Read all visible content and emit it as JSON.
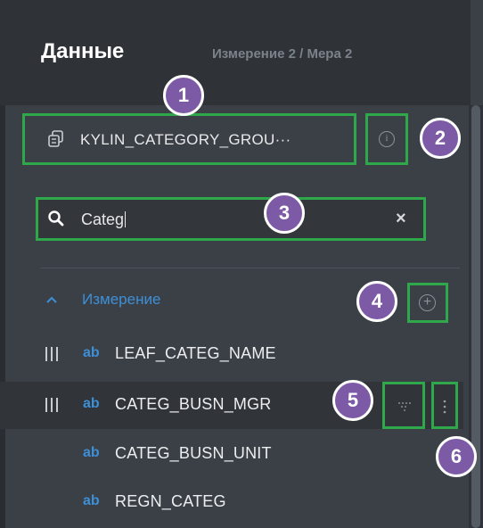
{
  "header": {
    "title": "Данные",
    "subtitle": "Измерение 2 / Мера 2"
  },
  "dataset": {
    "name": "KYLIN_CATEGORY_GROU···",
    "icon": "dataset-icon",
    "info_icon": "info-icon"
  },
  "search": {
    "value": "Categ",
    "clear_icon": "close-icon"
  },
  "group": {
    "label": "Измерение",
    "icon": "chevron-up-icon",
    "add_icon": "plus-circle-icon"
  },
  "fields": [
    {
      "type": "ab",
      "name": "LEAF_CATEG_NAME",
      "grip": true
    },
    {
      "type": "ab",
      "name": "CATEG_BUSN_MGR",
      "grip": true
    },
    {
      "type": "ab",
      "name": "CATEG_BUSN_UNIT",
      "grip": false
    },
    {
      "type": "ab",
      "name": "REGN_CATEG",
      "grip": false
    }
  ],
  "badges": [
    "1",
    "2",
    "3",
    "4",
    "5",
    "6"
  ],
  "colors": {
    "highlight": "#2ea84a",
    "accent": "#3d8fd6",
    "badge": "#7d5aa6",
    "panel": "#3b4047",
    "header": "#2f3338"
  }
}
